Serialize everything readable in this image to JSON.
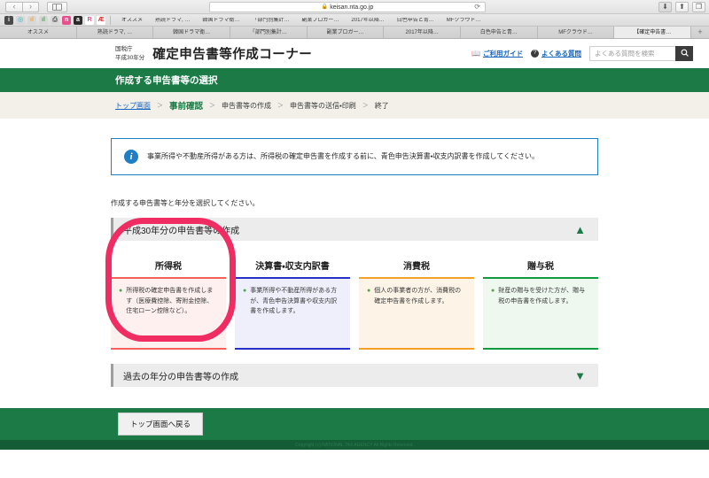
{
  "browser": {
    "back_icon": "‹",
    "forward_icon": "›",
    "sidebar_icon": "sidebar-icon",
    "url": "keisan.nta.go.jp",
    "lock_icon": "🔒",
    "reload_icon": "⟳",
    "download_icon": "⬇",
    "share_icon": "⬆",
    "tabs_icon": "❐",
    "favicons": [
      {
        "name": "fav-info",
        "glyph": "i",
        "bg": "#4a4a4a",
        "color": "#ffffff"
      },
      {
        "name": "fav-teal",
        "glyph": "◎",
        "bg": "#d8d8d8",
        "color": "#1fb6c4"
      },
      {
        "name": "fav-analytics",
        "glyph": "ıl",
        "bg": "#d8d8d8",
        "color": "#f4a33c"
      },
      {
        "name": "fav-analytics2",
        "glyph": "ıl",
        "bg": "#d8d8d8",
        "color": "#4aa94a"
      },
      {
        "name": "fav-printer",
        "glyph": "⎙",
        "bg": "#d8d8d8",
        "color": "#5a5a5a"
      },
      {
        "name": "fav-n",
        "glyph": "n",
        "bg": "#e8508d",
        "color": "#ffffff"
      },
      {
        "name": "fav-amazon",
        "glyph": "a",
        "bg": "#2b2b2b",
        "color": "#ffffff"
      },
      {
        "name": "fav-r",
        "glyph": "R",
        "bg": "#ffffff",
        "color": "#e8508d"
      },
      {
        "name": "fav-ae",
        "glyph": "Æ",
        "bg": "#ffffff",
        "color": "#e03030"
      }
    ],
    "favorites": [
      "オススメ",
      "熟読ドラマ, …",
      "韓国ドラマ衛…",
      "「部門別集計…",
      "副業ブロガー…",
      "2017年以降…",
      "白色申告と青…",
      "MFクラウド…"
    ],
    "tabs": [
      {
        "label": "オススメ",
        "active": false
      },
      {
        "label": "熟読ドラマ, …",
        "active": false
      },
      {
        "label": "韓国ドラマ衛…",
        "active": false
      },
      {
        "label": "「部門別集計…",
        "active": false
      },
      {
        "label": "副業ブロガー…",
        "active": false
      },
      {
        "label": "2017年以降…",
        "active": false
      },
      {
        "label": "白色申告と青…",
        "active": false
      },
      {
        "label": "MFクラウド…",
        "active": false
      },
      {
        "label": "【確定申告書…",
        "active": true
      }
    ],
    "new_tab_icon": "+"
  },
  "header": {
    "agency_line1": "国税庁",
    "agency_line2": "平成30年分",
    "title": "確定申告書等作成コーナー",
    "guide_icon": "📖",
    "guide_label": "ご利用ガイド",
    "faq_icon": "?",
    "faq_label": "よくある質問",
    "search_placeholder": "よくある質問を検索",
    "search_value": "",
    "search_icon": "🔍"
  },
  "band": {
    "title": "作成する申告書等の選択",
    "color": "#1b7a46"
  },
  "breadcrumb": {
    "separator": "＞",
    "items": [
      {
        "label": "トップ画面",
        "state": "link"
      },
      {
        "label": "事前確認",
        "state": "current"
      },
      {
        "label": "申告書等の作成",
        "state": "plain"
      },
      {
        "label": "申告書等の送信・印刷",
        "state": "plain"
      },
      {
        "label": "終了",
        "state": "plain"
      }
    ]
  },
  "notice": {
    "icon": "i",
    "text": "事業所得や不動産所得がある方は、所得税の確定申告書を作成する前に、青色申告決算書・収支内訳書を作成してください。",
    "border_color": "#1f7fc4"
  },
  "main": {
    "instruction": "作成する申告書等と年分を選択してください。",
    "accordion_open": {
      "label": "平成30年分の申告書等の作成",
      "arrow": "▲"
    },
    "accordion_closed": {
      "label": "過去の年分の申告書等の作成",
      "arrow": "▼"
    },
    "cards": [
      {
        "name": "card-income-tax",
        "title": "所得税",
        "bullet": "●",
        "description": "所得税の確定申告書を作成します（医療費控除、寄附金控除、住宅ローン控除など）。",
        "accent": "#f2605c",
        "body_bg": "#fdf0ef",
        "bullet_color": "#4aa94a",
        "highlighted": true
      },
      {
        "name": "card-settlement",
        "title": "決算書・収支内訳書",
        "bullet": "●",
        "description": "事業所得や不動産所得がある方が、青色申告決算書や収支内訳書を作成します。",
        "accent": "#2531c4",
        "body_bg": "#eeeffb",
        "bullet_color": "#4aa94a",
        "highlighted": false
      },
      {
        "name": "card-consumption-tax",
        "title": "消費税",
        "bullet": "●",
        "description": "個人の事業者の方が、消費税の確定申告書を作成します。",
        "accent": "#f2a029",
        "body_bg": "#fdf3e6",
        "bullet_color": "#4aa94a",
        "highlighted": false
      },
      {
        "name": "card-gift-tax",
        "title": "贈与税",
        "bullet": "●",
        "description": "財産の贈与を受けた方が、贈与税の申告書を作成します。",
        "accent": "#139a3f",
        "body_bg": "#eef8ef",
        "bullet_color": "#4aa94a",
        "highlighted": false
      }
    ]
  },
  "footer": {
    "back_to_top_label": "トップ画面へ戻る",
    "strip_text": "Copyright (c) NATIONAL TAX AGENCY All Rights Reserved."
  },
  "annotation": {
    "shape": "ellipse-highlight",
    "color": "#ef2d63",
    "target": "所得税"
  }
}
